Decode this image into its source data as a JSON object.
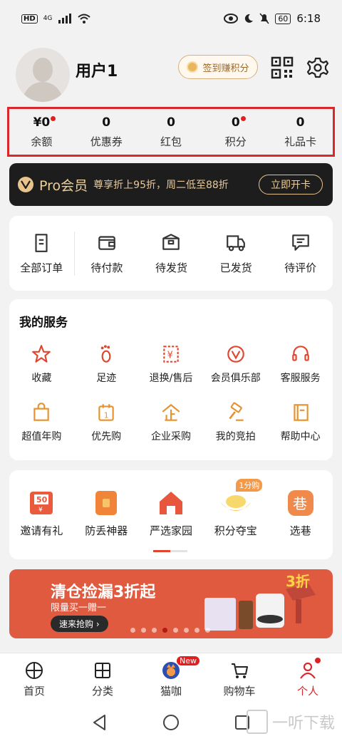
{
  "status_bar": {
    "time": "6:18",
    "network_label": "HD",
    "signal_label": "4G",
    "battery": "60"
  },
  "profile": {
    "username": "用户1",
    "signin_label": "签到赚积分"
  },
  "assets": [
    {
      "value": "¥0",
      "label": "余额",
      "dot": true
    },
    {
      "value": "0",
      "label": "优惠券",
      "dot": false
    },
    {
      "value": "0",
      "label": "红包",
      "dot": false
    },
    {
      "value": "0",
      "label": "积分",
      "dot": true
    },
    {
      "value": "0",
      "label": "礼品卡",
      "dot": false
    }
  ],
  "pro": {
    "title": "Pro会员",
    "desc": "尊享折上95折，周二低至88折",
    "button": "立即开卡"
  },
  "orders": [
    {
      "label": "全部订单",
      "icon": "clipboard-icon"
    },
    {
      "label": "待付款",
      "icon": "wallet-icon"
    },
    {
      "label": "待发货",
      "icon": "box-icon"
    },
    {
      "label": "已发货",
      "icon": "truck-icon"
    },
    {
      "label": "待评价",
      "icon": "comment-icon"
    }
  ],
  "services": {
    "title": "我的服务",
    "items": [
      {
        "label": "收藏",
        "icon": "star-icon"
      },
      {
        "label": "足迹",
        "icon": "footprint-icon"
      },
      {
        "label": "退换/售后",
        "icon": "refund-icon"
      },
      {
        "label": "会员俱乐部",
        "icon": "vip-club-icon"
      },
      {
        "label": "客服服务",
        "icon": "headset-icon"
      },
      {
        "label": "超值年购",
        "icon": "shopping-bag-icon"
      },
      {
        "label": "优先购",
        "icon": "priority-calendar-icon"
      },
      {
        "label": "企业采购",
        "icon": "enterprise-icon"
      },
      {
        "label": "我的竞拍",
        "icon": "gavel-icon"
      },
      {
        "label": "帮助中心",
        "icon": "help-book-icon"
      }
    ]
  },
  "promos": [
    {
      "label": "邀请有礼",
      "icon": "coupon-50-icon",
      "icon_text": "50"
    },
    {
      "label": "防丢神器",
      "icon": "tag-icon",
      "icon_text": ""
    },
    {
      "label": "严选家园",
      "icon": "home-icon",
      "icon_text": ""
    },
    {
      "label": "积分夺宝",
      "icon": "gold-ingot-icon",
      "icon_text": "",
      "tag": "1分购"
    },
    {
      "label": "选巷",
      "icon": "xuanxiang-icon",
      "icon_text": "巷"
    }
  ],
  "banner": {
    "title": "清仓捡漏3折起",
    "subtitle": "限量买一赠一",
    "button": "速来抢购 ›",
    "dots_count": 8,
    "active_dot": 3
  },
  "tabbar": [
    {
      "label": "首页",
      "icon": "home-tab-icon",
      "active": false
    },
    {
      "label": "分类",
      "icon": "category-icon",
      "active": false
    },
    {
      "label": "猫咖",
      "icon": "maoka-icon",
      "active": false,
      "badge": "New"
    },
    {
      "label": "购物车",
      "icon": "cart-icon",
      "active": false
    },
    {
      "label": "个人",
      "icon": "person-icon",
      "active": true,
      "dot": true
    }
  ],
  "watermark": "一听下载",
  "colors": {
    "accent": "#d8282c",
    "pro_gold": "#efcf98",
    "banner": "#e05a40",
    "icon_orange": "#e0462e"
  }
}
